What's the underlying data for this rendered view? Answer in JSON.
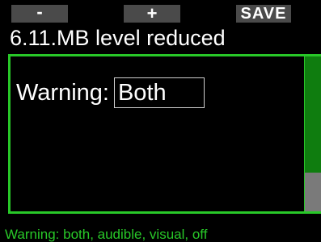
{
  "softkeys": {
    "left_label": "-",
    "middle_label": "+",
    "right_label": "SAVE"
  },
  "header": {
    "title": "6.11.MB level reduced"
  },
  "setting": {
    "label": "Warning:",
    "value": "Both"
  },
  "scrollbar": {
    "position_fraction": 0.0,
    "visible_fraction": 0.75
  },
  "footer": {
    "hint": "Warning: both, audible, visual, off"
  },
  "colors": {
    "accent_green": "#28c828",
    "scroll_thumb": "#0f7d0f",
    "softkey_bg": "#4a4a4a",
    "background": "#000000"
  }
}
